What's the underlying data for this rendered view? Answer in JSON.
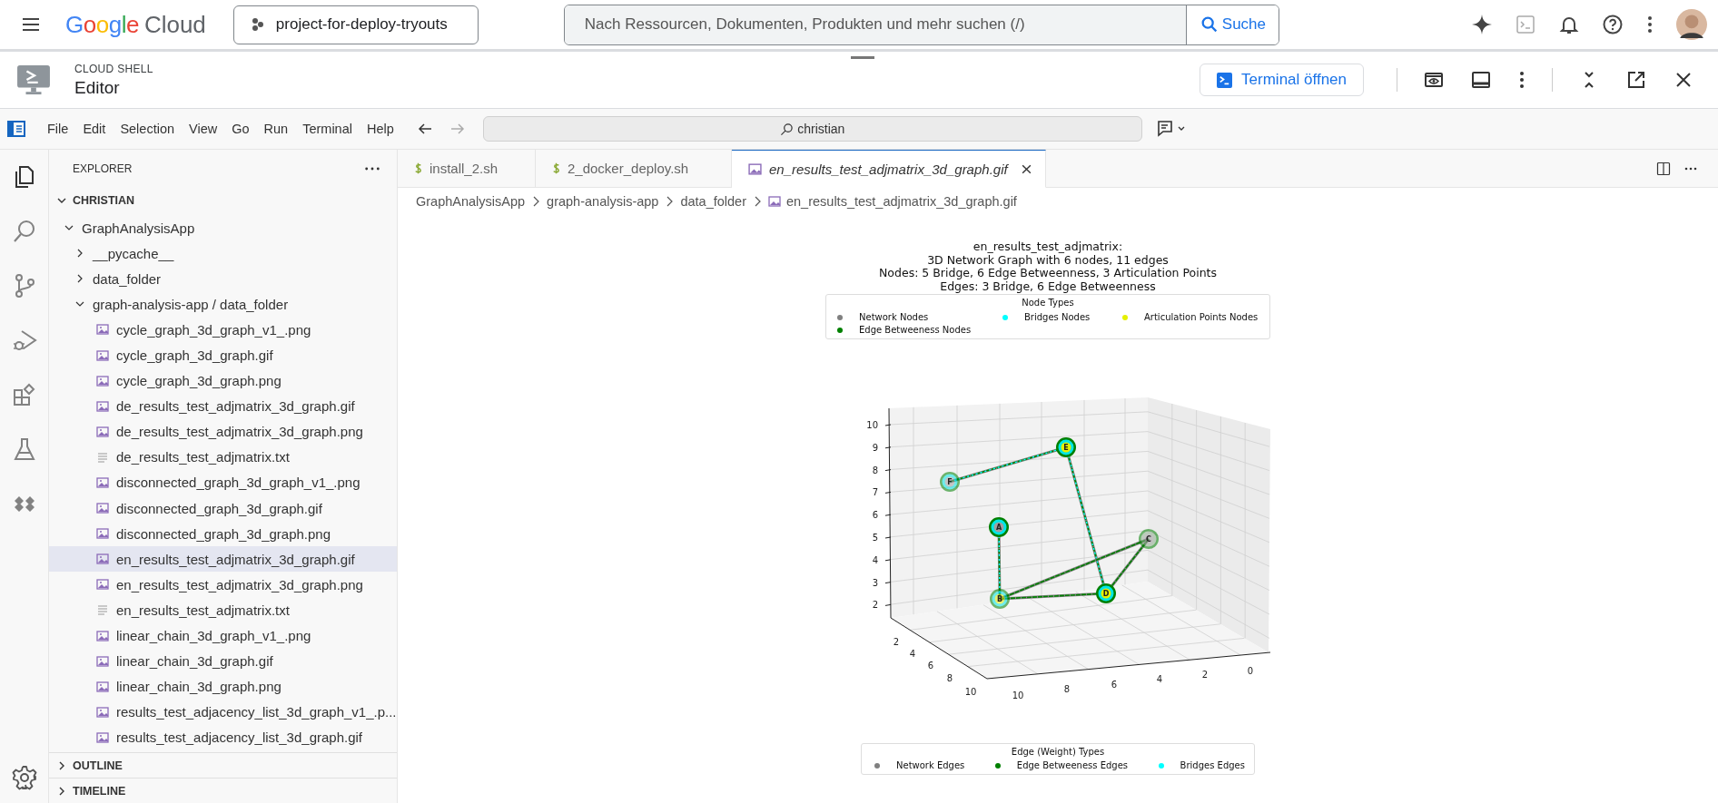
{
  "topbar": {
    "logo_word": "Google",
    "logo_product": "Cloud",
    "project": "project-for-deploy-tryouts",
    "search_placeholder": "Nach Ressourcen, Dokumenten, Produkten und mehr suchen (/)",
    "search_button": "Suche"
  },
  "shell_header": {
    "overline": "CLOUD SHELL",
    "title": "Editor",
    "terminal_button": "Terminal öffnen"
  },
  "menu": [
    "File",
    "Edit",
    "Selection",
    "View",
    "Go",
    "Run",
    "Terminal",
    "Help"
  ],
  "command_center": {
    "value": "christian"
  },
  "activity_bar": [
    {
      "kind": "files",
      "selected": true
    },
    {
      "kind": "search",
      "selected": false
    },
    {
      "kind": "source-control",
      "selected": false
    },
    {
      "kind": "run",
      "selected": false
    },
    {
      "kind": "extensions",
      "selected": false
    },
    {
      "kind": "testing",
      "selected": false
    },
    {
      "kind": "deploy",
      "selected": false
    }
  ],
  "explorer": {
    "title": "EXPLORER",
    "sections": [
      {
        "label": "CHRISTIAN",
        "expanded": true,
        "children": [
          {
            "label": "GraphAnalysisApp",
            "kind": "folder",
            "expanded": true,
            "selected": false,
            "children": [
              {
                "label": "__pycache__",
                "kind": "folder",
                "expanded": false,
                "selected": false
              },
              {
                "label": "data_folder",
                "kind": "folder",
                "expanded": false,
                "selected": false
              },
              {
                "label": "graph-analysis-app / data_folder",
                "kind": "folder",
                "expanded": true,
                "selected": false,
                "children": [
                  {
                    "label": "cycle_graph_3d_graph_v1_.png",
                    "kind": "image",
                    "selected": false
                  },
                  {
                    "label": "cycle_graph_3d_graph.gif",
                    "kind": "image",
                    "selected": false
                  },
                  {
                    "label": "cycle_graph_3d_graph.png",
                    "kind": "image",
                    "selected": false
                  },
                  {
                    "label": "de_results_test_adjmatrix_3d_graph.gif",
                    "kind": "image",
                    "selected": false
                  },
                  {
                    "label": "de_results_test_adjmatrix_3d_graph.png",
                    "kind": "image",
                    "selected": false
                  },
                  {
                    "label": "de_results_test_adjmatrix.txt",
                    "kind": "text",
                    "selected": false
                  },
                  {
                    "label": "disconnected_graph_3d_graph_v1_.png",
                    "kind": "image",
                    "selected": false
                  },
                  {
                    "label": "disconnected_graph_3d_graph.gif",
                    "kind": "image",
                    "selected": false
                  },
                  {
                    "label": "disconnected_graph_3d_graph.png",
                    "kind": "image",
                    "selected": false
                  },
                  {
                    "label": "en_results_test_adjmatrix_3d_graph.gif",
                    "kind": "image",
                    "selected": true
                  },
                  {
                    "label": "en_results_test_adjmatrix_3d_graph.png",
                    "kind": "image",
                    "selected": false
                  },
                  {
                    "label": "en_results_test_adjmatrix.txt",
                    "kind": "text",
                    "selected": false
                  },
                  {
                    "label": "linear_chain_3d_graph_v1_.png",
                    "kind": "image",
                    "selected": false
                  },
                  {
                    "label": "linear_chain_3d_graph.gif",
                    "kind": "image",
                    "selected": false
                  },
                  {
                    "label": "linear_chain_3d_graph.png",
                    "kind": "image",
                    "selected": false
                  },
                  {
                    "label": "results_test_adjacency_list_3d_graph_v1_.p...",
                    "kind": "image",
                    "selected": false
                  },
                  {
                    "label": "results_test_adjacency_list_3d_graph.gif",
                    "kind": "image",
                    "selected": false
                  }
                ]
              }
            ]
          }
        ]
      },
      {
        "label": "OUTLINE",
        "expanded": false
      },
      {
        "label": "TIMELINE",
        "expanded": false
      }
    ]
  },
  "tabs": [
    {
      "label": "install_2.sh",
      "kind": "shell",
      "selected": false,
      "preview": false
    },
    {
      "label": "2_docker_deploy.sh",
      "kind": "shell",
      "selected": false,
      "preview": false
    },
    {
      "label": "en_results_test_adjmatrix_3d_graph.gif",
      "kind": "image",
      "selected": true,
      "preview": true
    }
  ],
  "breadcrumb": [
    "GraphAnalysisApp",
    "graph-analysis-app",
    "data_folder",
    "en_results_test_adjmatrix_3d_graph.gif"
  ],
  "figure": {
    "title_lines": [
      "en_results_test_adjmatrix:",
      "3D Network Graph with 6 nodes, 11 edges",
      "Nodes: 5 Bridge, 6 Edge Betweenness, 3 Articulation Points",
      "Edges: 3 Bridge, 6 Edge Betweenness"
    ],
    "node_legend": {
      "title": "Node Types",
      "items": [
        {
          "label": "Network Nodes",
          "color": "#808080"
        },
        {
          "label": "Bridges Nodes",
          "color": "#00ffff"
        },
        {
          "label": "Articulation Points Nodes",
          "color": "#e5f000"
        },
        {
          "label": "Edge Betweeness Nodes",
          "color": "#008000"
        }
      ]
    },
    "z_ticks": [
      "10",
      "9",
      "8",
      "7",
      "6",
      "5",
      "4",
      "3",
      "2"
    ],
    "y_ticks": [
      "2",
      "4",
      "6",
      "8",
      "10"
    ],
    "x_ticks": [
      "10",
      "8",
      "6",
      "4",
      "2",
      "0"
    ],
    "nodes": [
      {
        "label": "A",
        "articulation": false
      },
      {
        "label": "B",
        "articulation": true
      },
      {
        "label": "C",
        "articulation": false
      },
      {
        "label": "D",
        "articulation": true
      },
      {
        "label": "E",
        "articulation": true
      },
      {
        "label": "F",
        "articulation": false
      }
    ],
    "edge_legend": {
      "title": "Edge (Weight) Types",
      "items": [
        {
          "label": "Network Edges",
          "color": "#808080"
        },
        {
          "label": "Edge Betweeness Edges",
          "color": "#008000"
        },
        {
          "label": "Bridges Edges",
          "color": "#00ffff"
        }
      ]
    }
  }
}
